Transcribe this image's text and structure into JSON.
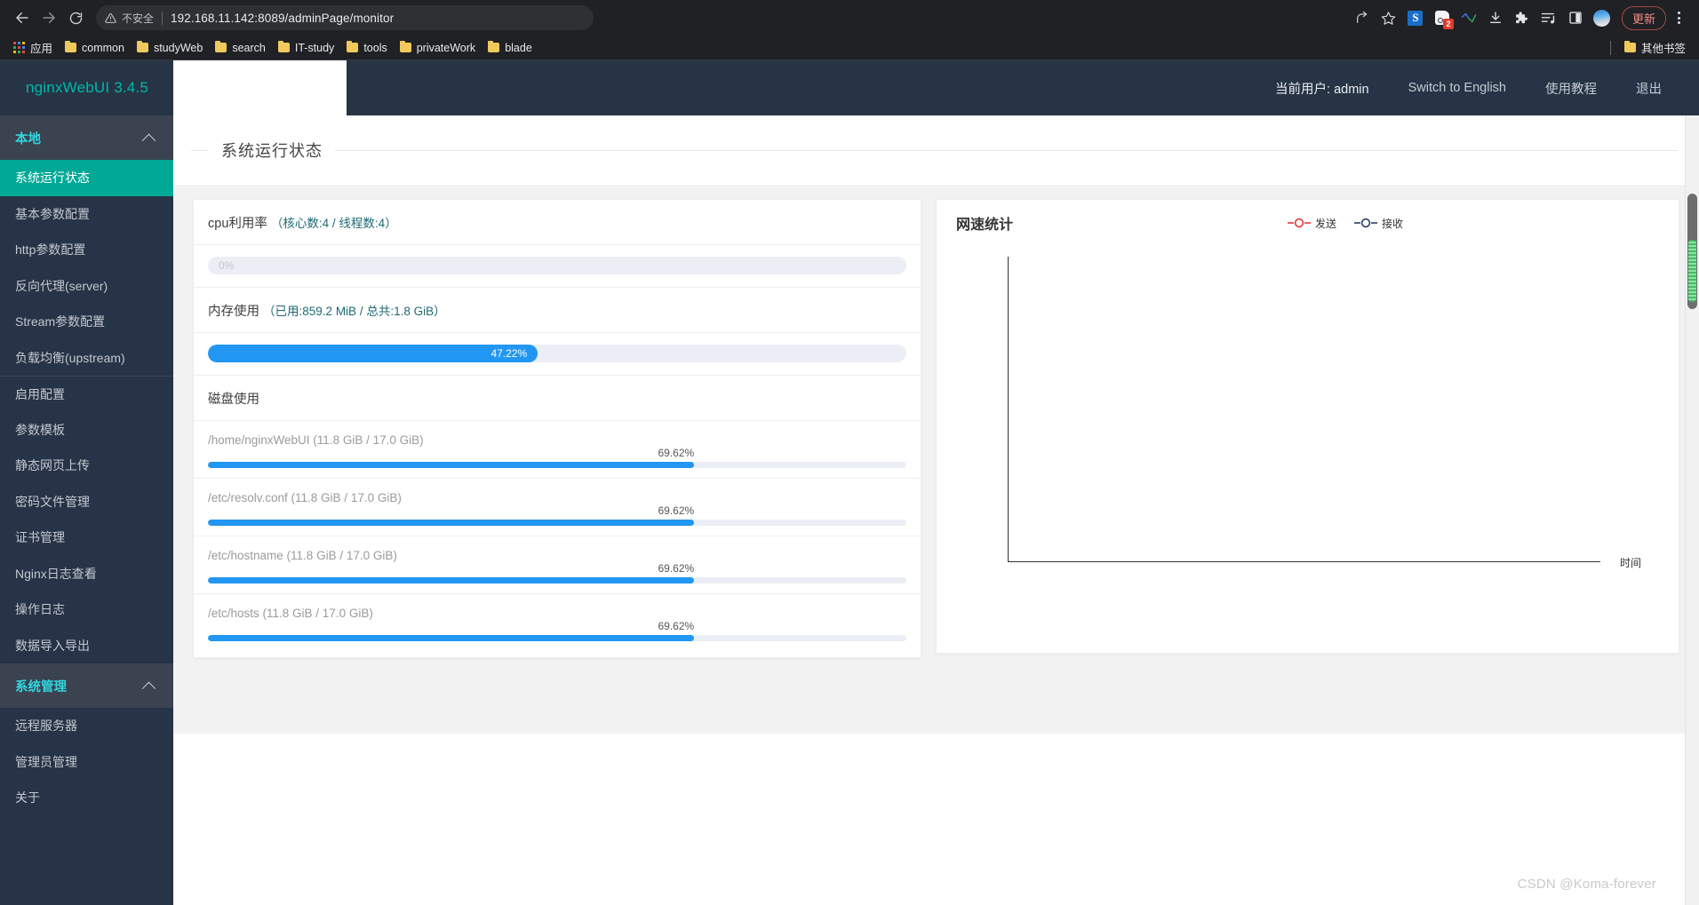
{
  "browser": {
    "nav": {
      "back": "back-arrow",
      "forward": "forward-arrow",
      "reload": "reload"
    },
    "omnibox": {
      "security_label": "不安全",
      "url_host": "192.168.11.142",
      "url_path": ":8089/adminPage/monitor",
      "full_url": "192.168.11.142:8089/adminPage/monitor"
    },
    "toolbar_icons": [
      "share-icon",
      "star-icon",
      "sogou-extension-icon",
      "screenshot-extension-icon",
      "tampermonkey-icon",
      "download-icon",
      "puzzle-extension-icon",
      "reading-list-icon",
      "split-view-icon",
      "profile-avatar"
    ],
    "extension_badge": "2",
    "update_label": "更新",
    "menu_label": "chrome-menu",
    "bookmarks": {
      "apps_label": "应用",
      "items": [
        {
          "label": "common"
        },
        {
          "label": "studyWeb"
        },
        {
          "label": "search"
        },
        {
          "label": "IT-study"
        },
        {
          "label": "tools"
        },
        {
          "label": "privateWork"
        },
        {
          "label": "blade"
        }
      ],
      "other_label": "其他书签"
    }
  },
  "app": {
    "brand": "nginxWebUI 3.4.5",
    "header": {
      "current_user": "当前用户: admin",
      "switch_language": "Switch to English",
      "tutorial": "使用教程",
      "logout": "退出"
    },
    "sidebar": {
      "groups": [
        {
          "title": "本地",
          "items": [
            {
              "label": "系统运行状态",
              "active": true
            },
            {
              "label": "基本参数配置",
              "active": false
            },
            {
              "label": "http参数配置",
              "active": false
            },
            {
              "label": "反向代理(server)",
              "active": false
            },
            {
              "label": "Stream参数配置",
              "active": false
            },
            {
              "label": "负载均衡(upstream)",
              "active": false
            },
            {
              "label": "启用配置",
              "active": false,
              "divider_above": true
            },
            {
              "label": "参数模板",
              "active": false
            },
            {
              "label": "静态网页上传",
              "active": false
            },
            {
              "label": "密码文件管理",
              "active": false
            },
            {
              "label": "证书管理",
              "active": false
            },
            {
              "label": "Nginx日志查看",
              "active": false
            },
            {
              "label": "操作日志",
              "active": false
            },
            {
              "label": "数据导入导出",
              "active": false
            }
          ]
        },
        {
          "title": "系统管理",
          "items": [
            {
              "label": "远程服务器",
              "active": false
            },
            {
              "label": "管理员管理",
              "active": false
            },
            {
              "label": "关于",
              "active": false
            }
          ]
        }
      ]
    },
    "page_title": "系统运行状态",
    "monitor": {
      "cpu": {
        "label": "cpu利用率",
        "detail": "（核心数:4 / 线程数:4）",
        "percent_label": "0%",
        "percent": 0
      },
      "memory": {
        "label": "内存使用",
        "detail": "（已用:859.2 MiB / 总共:1.8 GiB）",
        "percent_label": "47.22%",
        "percent": 47.22
      },
      "disk": {
        "label": "磁盘使用",
        "items": [
          {
            "name": "/home/nginxWebUI (11.8 GiB / 17.0 GiB)",
            "percent_label": "69.62%",
            "percent": 69.62
          },
          {
            "name": "/etc/resolv.conf (11.8 GiB / 17.0 GiB)",
            "percent_label": "69.62%",
            "percent": 69.62
          },
          {
            "name": "/etc/hostname (11.8 GiB / 17.0 GiB)",
            "percent_label": "69.62%",
            "percent": 69.62
          },
          {
            "name": "/etc/hosts (11.8 GiB / 17.0 GiB)",
            "percent_label": "69.62%",
            "percent": 69.62
          }
        ]
      }
    },
    "watermark": "CSDN @Koma-forever"
  },
  "chart_data": {
    "type": "line",
    "title": "网速统计",
    "xlabel": "时间",
    "ylabel": "",
    "grid": false,
    "legend_position": "top-right",
    "series": [
      {
        "name": "发送",
        "color": "#e4393c",
        "values": []
      },
      {
        "name": "接收",
        "color": "#2c3e60",
        "values": []
      }
    ],
    "x": [],
    "note": "Empty plot — axes drawn, no data points rendered yet"
  }
}
